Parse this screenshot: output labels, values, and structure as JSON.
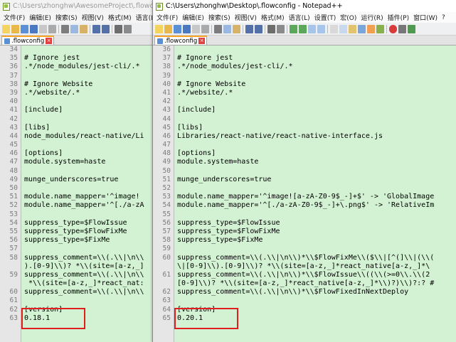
{
  "left_window": {
    "title": "C:\\Users\\zhonghw\\AwesomeProject\\.flowconfig - No",
    "menu": [
      "文件(F)",
      "编辑(E)",
      "搜索(S)",
      "视图(V)",
      "格式(M)",
      "语言(L)"
    ],
    "tab": {
      "label": ".flowconfig",
      "close": "×"
    },
    "lines": [
      {
        "n": "34",
        "t": ""
      },
      {
        "n": "35",
        "t": "# Ignore jest"
      },
      {
        "n": "36",
        "t": ".*/node_modules/jest-cli/.*"
      },
      {
        "n": "37",
        "t": ""
      },
      {
        "n": "38",
        "t": "# Ignore Website"
      },
      {
        "n": "39",
        "t": ".*/website/.*"
      },
      {
        "n": "40",
        "t": ""
      },
      {
        "n": "41",
        "t": "[include]"
      },
      {
        "n": "42",
        "t": ""
      },
      {
        "n": "43",
        "t": "[libs]"
      },
      {
        "n": "44",
        "t": "node_modules/react-native/Li"
      },
      {
        "n": "45",
        "t": ""
      },
      {
        "n": "46",
        "t": "[options]"
      },
      {
        "n": "47",
        "t": "module.system=haste"
      },
      {
        "n": "48",
        "t": ""
      },
      {
        "n": "49",
        "t": "munge_underscores=true"
      },
      {
        "n": "50",
        "t": ""
      },
      {
        "n": "51",
        "t": "module.name_mapper='^image!"
      },
      {
        "n": "52",
        "t": "module.name_mapper='^[./a-zA"
      },
      {
        "n": "53",
        "t": ""
      },
      {
        "n": "54",
        "t": "suppress_type=$FlowIssue"
      },
      {
        "n": "55",
        "t": "suppress_type=$FlowFixMe"
      },
      {
        "n": "56",
        "t": "suppress_type=$FixMe"
      },
      {
        "n": "57",
        "t": ""
      },
      {
        "n": "58",
        "t": "suppress_comment=\\\\(.\\\\|\\n\\\\"
      },
      {
        "n": "",
        "t": ").[0-9]\\\\)? *\\\\(site=[a-z,_]"
      },
      {
        "n": "59",
        "t": "suppress_comment=\\\\(.\\\\|\\n\\\\"
      },
      {
        "n": "",
        "t": " *\\\\(site=[a-z,_]*react_nat:"
      },
      {
        "n": "60",
        "t": "suppress_comment=\\\\(.\\\\|\\n\\\\"
      },
      {
        "n": "61",
        "t": ""
      },
      {
        "n": "62",
        "t": "[version]"
      },
      {
        "n": "63",
        "t": "0.18.1"
      }
    ]
  },
  "right_window": {
    "title": "C:\\Users\\zhonghw\\Desktop\\.flowconfig - Notepad++",
    "menu": [
      "文件(F)",
      "编辑(E)",
      "搜索(S)",
      "视图(V)",
      "格式(M)",
      "语言(L)",
      "设置(T)",
      "宏(O)",
      "运行(R)",
      "插件(P)",
      "窗口(W)",
      "?"
    ],
    "tab": {
      "label": ".flowconfig",
      "close": "×"
    },
    "lines": [
      {
        "n": "36",
        "t": ""
      },
      {
        "n": "37",
        "t": "# Ignore jest"
      },
      {
        "n": "38",
        "t": ".*/node_modules/jest-cli/.*"
      },
      {
        "n": "39",
        "t": ""
      },
      {
        "n": "40",
        "t": "# Ignore Website"
      },
      {
        "n": "41",
        "t": ".*/website/.*"
      },
      {
        "n": "42",
        "t": ""
      },
      {
        "n": "43",
        "t": "[include]"
      },
      {
        "n": "44",
        "t": ""
      },
      {
        "n": "45",
        "t": "[libs]"
      },
      {
        "n": "46",
        "t": "Libraries/react-native/react-native-interface.js"
      },
      {
        "n": "47",
        "t": ""
      },
      {
        "n": "48",
        "t": "[options]"
      },
      {
        "n": "49",
        "t": "module.system=haste"
      },
      {
        "n": "50",
        "t": ""
      },
      {
        "n": "51",
        "t": "munge_underscores=true"
      },
      {
        "n": "52",
        "t": ""
      },
      {
        "n": "53",
        "t": "module.name_mapper='^image![a-zA-Z0-9$_-]+$' -> 'GlobalImage"
      },
      {
        "n": "54",
        "t": "module.name_mapper='^[./a-zA-Z0-9$_-]+\\.png$' -> 'RelativeIm"
      },
      {
        "n": "55",
        "t": ""
      },
      {
        "n": "56",
        "t": "suppress_type=$FlowIssue"
      },
      {
        "n": "57",
        "t": "suppress_type=$FlowFixMe"
      },
      {
        "n": "58",
        "t": "suppress_type=$FixMe"
      },
      {
        "n": "59",
        "t": ""
      },
      {
        "n": "60",
        "t": "suppress_comment=\\\\(.\\\\|\\n\\\\)*\\\\$FlowFixMe\\\\($\\\\|[^(]\\\\|(\\\\("
      },
      {
        "n": "",
        "t": "\\|[0-9]\\\\).[0-9]\\\\)? *\\\\(site=[a-z,_]*react_native[a-z,_]*\\"
      },
      {
        "n": "61",
        "t": "suppress_comment=\\\\(.\\\\|\\n\\\\)*\\\\$FlowIssue\\\\((\\\\(>=0\\\\.\\\\(2"
      },
      {
        "n": "",
        "t": "[0-9]\\\\)? *\\\\(site=[a-z,_]*react_native[a-z,_]*\\\\)?)\\\\)?:? #"
      },
      {
        "n": "62",
        "t": "suppress_comment=\\\\(.\\\\|\\n\\\\)*\\\\$FlowFixedInNextDeploy"
      },
      {
        "n": "63",
        "t": ""
      },
      {
        "n": "64",
        "t": "[version]"
      },
      {
        "n": "65",
        "t": "0.20.1"
      }
    ]
  },
  "colors": {
    "editor_bg": "#d3f2d3",
    "gutter_bg": "#e6e6e6",
    "highlight_border": "#e02020",
    "tab_accent": "#f7a323"
  }
}
